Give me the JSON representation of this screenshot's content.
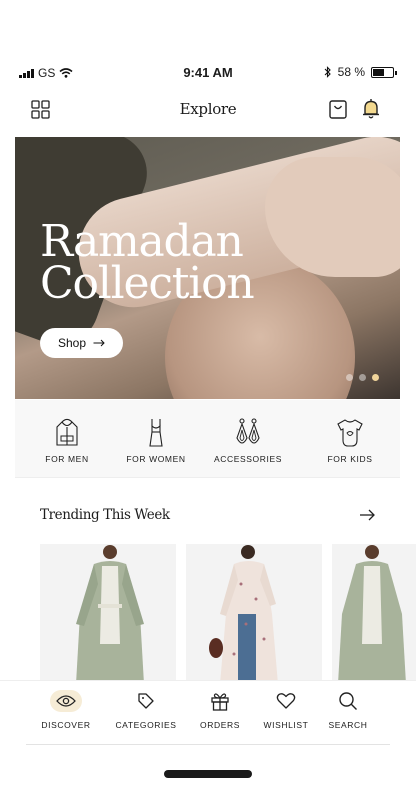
{
  "status_bar": {
    "carrier": "GS",
    "time": "9:41 AM",
    "battery_text": "58 %",
    "battery_level": 0.58,
    "icons": [
      "signal-icon",
      "wifi-icon",
      "bluetooth-icon",
      "battery-icon"
    ]
  },
  "nav": {
    "title": "Explore",
    "icons": [
      "grid-icon",
      "shopping-bag-icon",
      "bell-icon"
    ],
    "bell_accent": "#d9a441"
  },
  "hero": {
    "headline_line1": "Ramadan",
    "headline_line2": "Collection",
    "cta_label": "Shop",
    "cta_icon": "arrow-right-icon",
    "slides_count": 3,
    "active_slide": 3,
    "active_dot_color": "#f0d49a"
  },
  "categories": [
    {
      "label": "FOR MEN",
      "icon": "hoodie-icon"
    },
    {
      "label": "FOR WOMEN",
      "icon": "dress-icon"
    },
    {
      "label": "ACCESSORIES",
      "icon": "earrings-icon"
    },
    {
      "label": "FOR KIDS",
      "icon": "onesie-icon"
    }
  ],
  "trending": {
    "title": "Trending This Week",
    "see_all_icon": "arrow-right-icon"
  },
  "tabs": [
    {
      "label": "DISCOVER",
      "icon": "eye-icon",
      "active": true
    },
    {
      "label": "CATEGORIES",
      "icon": "tag-icon",
      "active": false
    },
    {
      "label": "ORDERS",
      "icon": "gift-icon",
      "active": false
    },
    {
      "label": "WISHLIST",
      "icon": "heart-icon",
      "active": false
    },
    {
      "label": "SEARCH",
      "icon": "search-icon",
      "active": false
    }
  ],
  "colors": {
    "accent": "#f6ecd6",
    "text": "#1c1c1c"
  }
}
